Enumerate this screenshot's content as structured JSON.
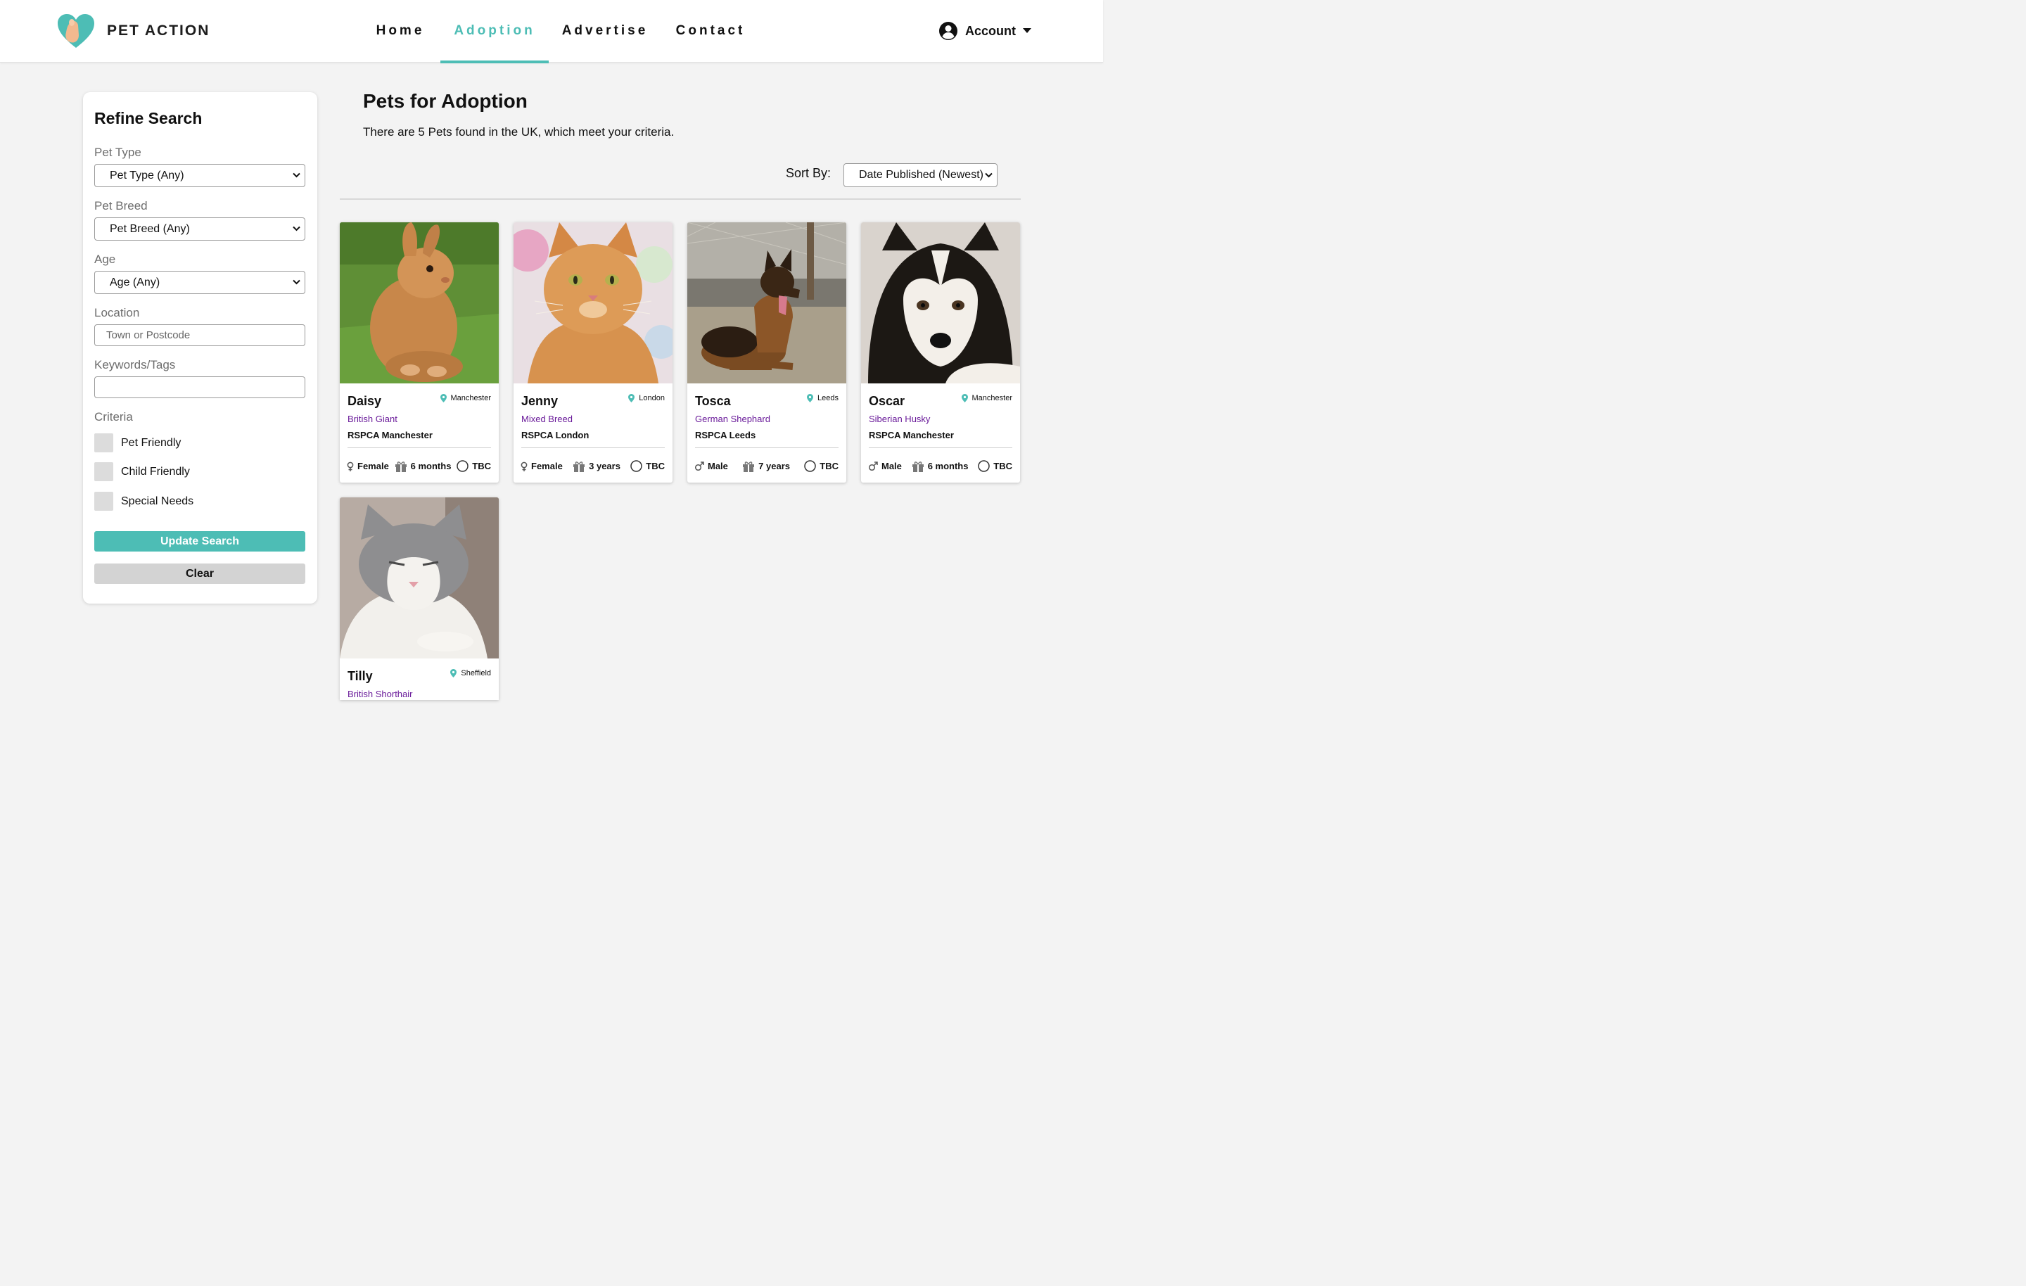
{
  "brand": {
    "name": "PET ACTION"
  },
  "nav": [
    {
      "label": "Home",
      "active": false
    },
    {
      "label": "Adoption",
      "active": true
    },
    {
      "label": "Advertise",
      "active": false
    },
    {
      "label": "Contact",
      "active": false
    }
  ],
  "account": {
    "label": "Account"
  },
  "colors": {
    "accent": "#4dbdb5",
    "breed": "#6a1b9a",
    "checkbox": "#dcdcdc",
    "secondary_button": "#d3d3d3"
  },
  "sidebar": {
    "title": "Refine Search",
    "pet_type": {
      "label": "Pet Type",
      "value": "Pet Type (Any)"
    },
    "pet_breed": {
      "label": "Pet Breed",
      "value": "Pet Breed (Any)"
    },
    "age": {
      "label": "Age",
      "value": "Age (Any)"
    },
    "location": {
      "label": "Location",
      "placeholder": "Town or Postcode",
      "value": ""
    },
    "keywords": {
      "label": "Keywords/Tags",
      "placeholder": "",
      "value": ""
    },
    "criteria": {
      "label": "Criteria",
      "options": [
        {
          "label": "Pet Friendly",
          "checked": false
        },
        {
          "label": "Child Friendly",
          "checked": false
        },
        {
          "label": "Special Needs",
          "checked": false
        }
      ]
    },
    "update_button": "Update Search",
    "clear_button": "Clear"
  },
  "main": {
    "title": "Pets for Adoption",
    "result_text": "There are 5 Pets found in the UK, which meet your criteria.",
    "sort": {
      "label": "Sort By:",
      "value": "Date Published (Newest)"
    }
  },
  "pets": [
    {
      "name": "Daisy",
      "location": "Manchester",
      "breed": "British Giant",
      "shelter": "RSPCA Manchester",
      "sex": "Female",
      "age": "6 months",
      "status": "TBC",
      "photo": "rabbit"
    },
    {
      "name": "Jenny",
      "location": "London",
      "breed": "Mixed Breed",
      "shelter": "RSPCA London",
      "sex": "Female",
      "age": "3 years",
      "status": "TBC",
      "photo": "ginger-cat"
    },
    {
      "name": "Tosca",
      "location": "Leeds",
      "breed": "German Shephard",
      "shelter": "RSPCA Leeds",
      "sex": "Male",
      "age": "7 years",
      "status": "TBC",
      "photo": "german-shepherd"
    },
    {
      "name": "Oscar",
      "location": "Manchester",
      "breed": "Siberian Husky",
      "shelter": "RSPCA Manchester",
      "sex": "Male",
      "age": "6 months",
      "status": "TBC",
      "photo": "husky-puppy"
    },
    {
      "name": "Tilly",
      "location": "Sheffield",
      "breed": "British Shorthair",
      "shelter": "",
      "sex": "",
      "age": "",
      "status": "",
      "photo": "grey-white-cat"
    }
  ]
}
